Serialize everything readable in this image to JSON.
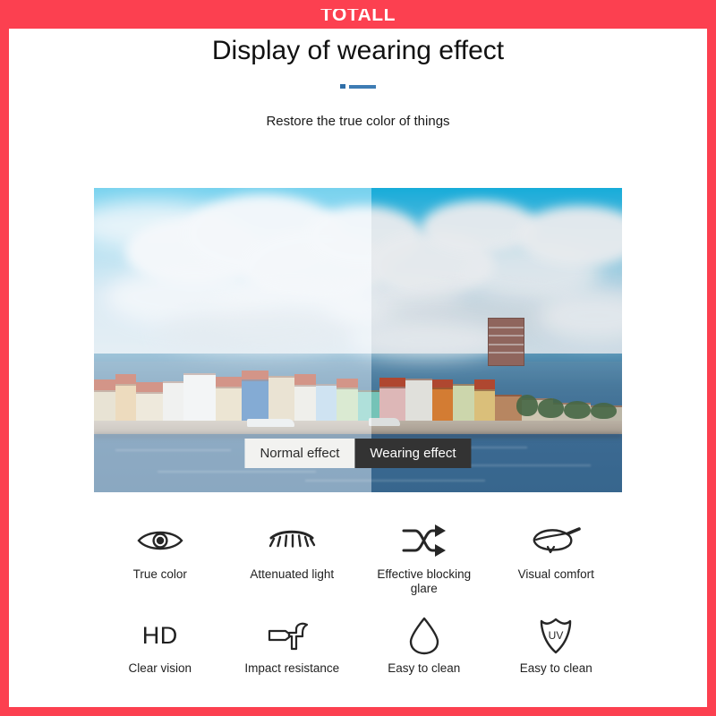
{
  "brand": {
    "name": "TOTALL"
  },
  "header": {
    "title": "Display of wearing effect",
    "subtitle": "Restore the true color of things"
  },
  "colors": {
    "frame_red": "#fc4050",
    "divider_blue": "#3e7cb4",
    "divider_dot": "#2f6ea8",
    "label_light_bg": "#f2f2f0",
    "label_dark_bg": "#333333",
    "text_dark": "#1f1f1f"
  },
  "comparison": {
    "image_description": "Aerial photo of the Willemstad Curacao waterfront with colorful row houses, harbour and cloudy blue sky, split vertically into a hazy left half and a clearer, more saturated right half",
    "left_label": "Normal effect",
    "right_label": "Wearing effect",
    "split_percent": 52.5
  },
  "features": {
    "rows": [
      [
        {
          "icon": "eye-icon",
          "label": "True color"
        },
        {
          "icon": "closed-eye-lashes-icon",
          "label": "Attenuated light"
        },
        {
          "icon": "shuffle-arrows-icon",
          "label": "Effective blocking glare"
        },
        {
          "icon": "leaf-eye-icon",
          "label": "Visual comfort"
        }
      ],
      [
        {
          "icon": "hd-text-icon",
          "icon_text": "HD",
          "label": "Clear vision"
        },
        {
          "icon": "hammer-icon",
          "label": "Impact resistance"
        },
        {
          "icon": "water-drop-icon",
          "label": "Easy to clean"
        },
        {
          "icon": "uv-shield-icon",
          "icon_text": "UV",
          "label": "Easy to clean"
        }
      ]
    ]
  }
}
